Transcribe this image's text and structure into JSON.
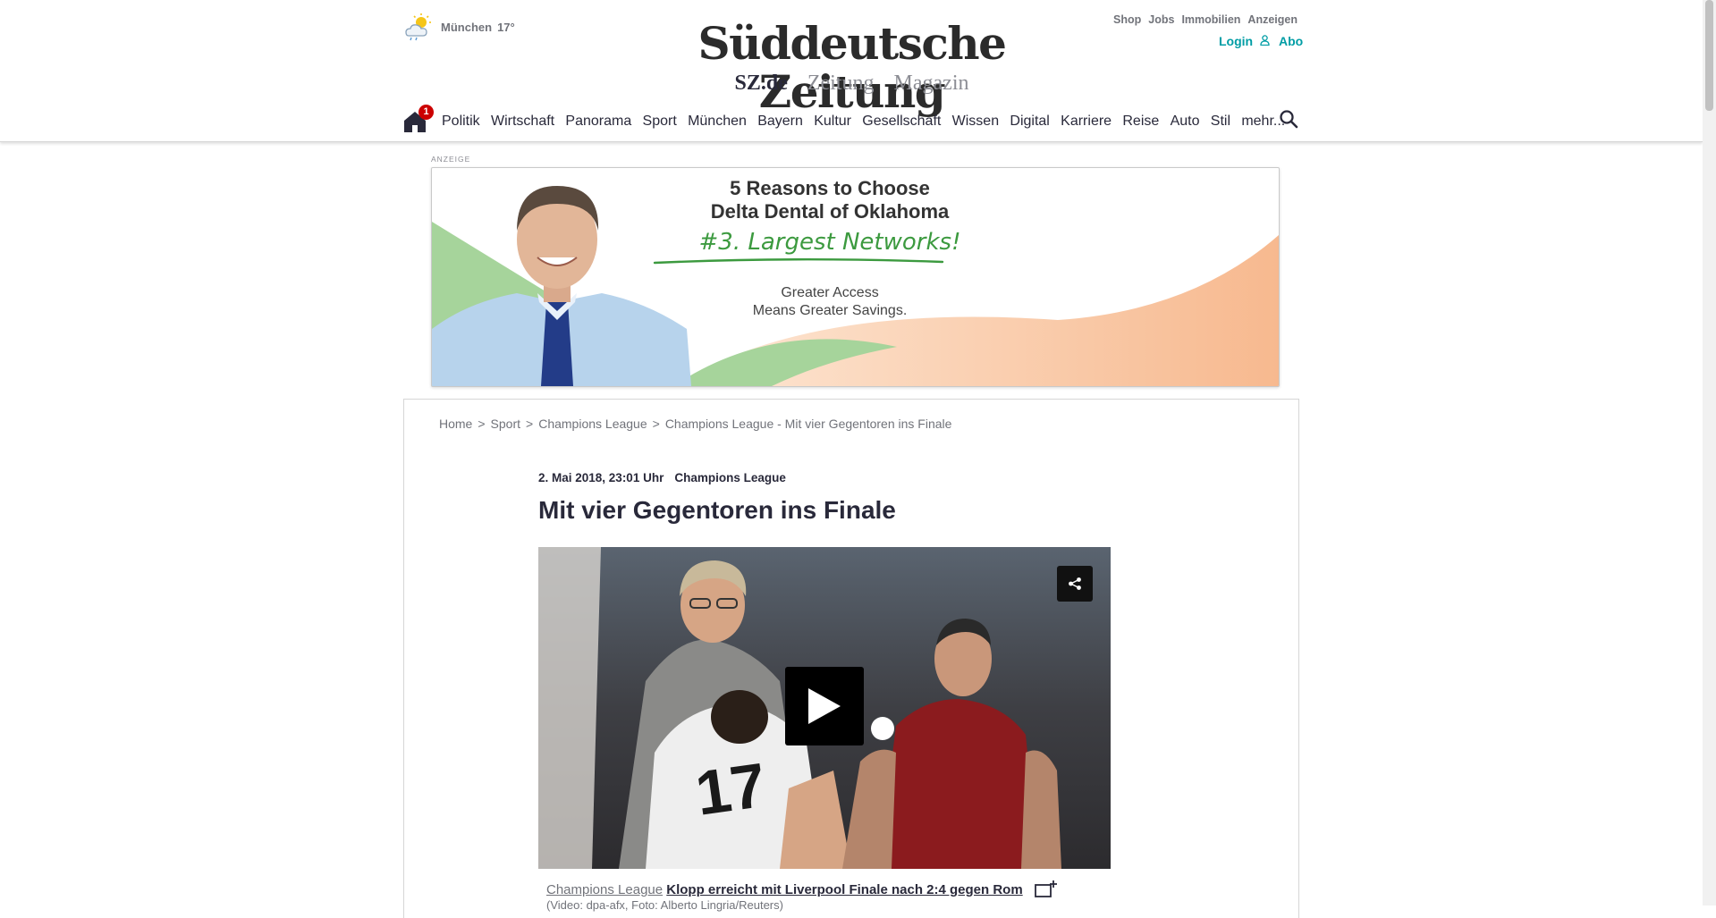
{
  "header": {
    "weather": {
      "city": "München",
      "temp": "17°",
      "icon": "sun-cloud-icon"
    },
    "logo": "Süddeutsche Zeitung",
    "sublinks": [
      "SZ.de",
      "Zeitung",
      "Magazin"
    ],
    "top_links": [
      "Shop",
      "Jobs",
      "Immobilien",
      "Anzeigen"
    ],
    "login": "Login",
    "abo": "Abo"
  },
  "nav": {
    "home_badge": "1",
    "items": [
      "Politik",
      "Wirtschaft",
      "Panorama",
      "Sport",
      "München",
      "Bayern",
      "Kultur",
      "Gesellschaft",
      "Wissen",
      "Digital",
      "Karriere",
      "Reise",
      "Auto",
      "Stil",
      "mehr..."
    ]
  },
  "ad": {
    "label": "ANZEIGE",
    "title_line1": "5 Reasons to Choose",
    "title_line2": "Delta Dental of Oklahoma",
    "highlight": "#3. Largest Networks!",
    "sub_line1": "Greater Access",
    "sub_line2": "Means Greater Savings."
  },
  "breadcrumb": [
    "Home",
    "Sport",
    "Champions League",
    "Champions League - Mit vier Gegentoren ins Finale"
  ],
  "article": {
    "date": "2. Mai 2018, 23:01 Uhr",
    "category": "Champions League",
    "headline": "Mit vier Gegentoren ins Finale",
    "caption_category": "Champions League",
    "caption_link": "Klopp erreicht mit Liverpool Finale nach 2:4 gegen Rom",
    "caption_credit": "(Video: dpa-afx, Foto: Alberto Lingria/Reuters)"
  },
  "colors": {
    "accent": "#009da5",
    "badge": "#cc0000",
    "text": "#29293a"
  }
}
